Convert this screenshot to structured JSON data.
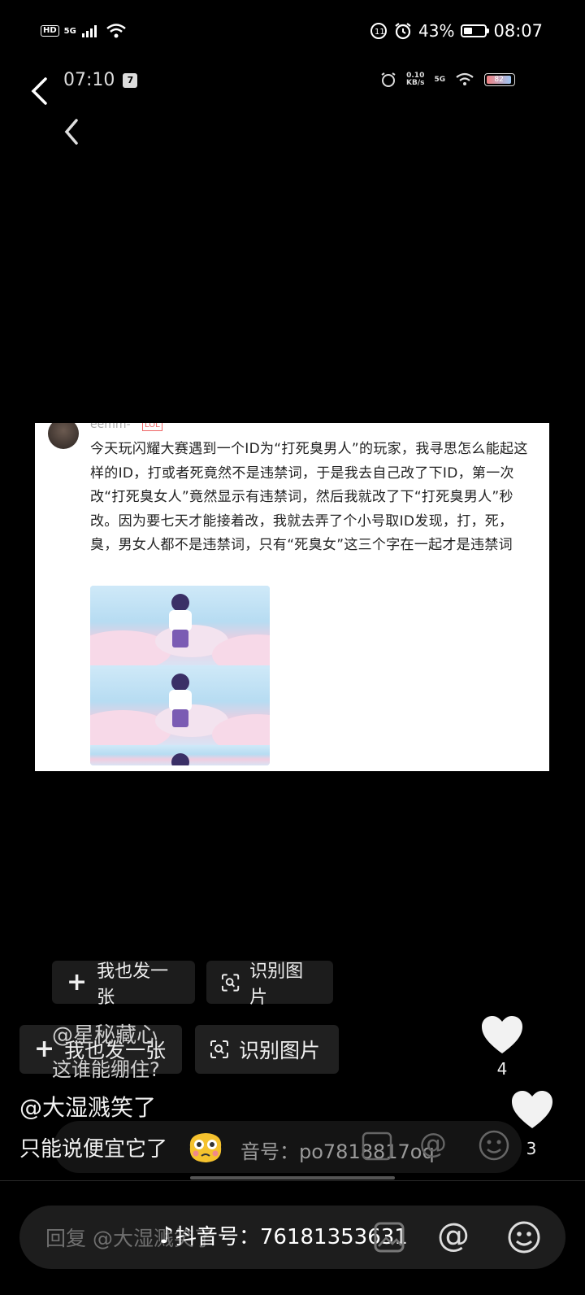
{
  "status_bar": {
    "network_badge": "HD",
    "network_type": "5G",
    "battery_percent": "43%",
    "time": "08:07"
  },
  "inner_status": {
    "time": "07:10",
    "calendar_badge": "7",
    "net_speed_top": "0.10",
    "net_speed_unit": "KB/s",
    "net_type": "5G",
    "battery_level": "82"
  },
  "post": {
    "username": "eemm-",
    "user_tag": "LOL",
    "text": "今天玩闪耀大赛遇到一个ID为“打死臭男人”的玩家，我寻思怎么能起这样的ID，打或者死竟然不是违禁词，于是我去自己改了下ID，第一次改“打死臭女人”竟然显示有违禁词，然后我就改了下“打死臭男人”秒改。因为要七天才能接着改，我就去弄了个小号取ID发现，打，死，臭，男女人都不是违禁词，只有“死臭女”这三个字在一起才是违禁词"
  },
  "actions_upper": {
    "post_one": "我也发一张",
    "recognize": "识别图片"
  },
  "actions_lower": {
    "post_one": "我也发一张",
    "recognize": "识别图片"
  },
  "comments": [
    {
      "user": "@星秘藏心",
      "text": "这谁能绷住?",
      "likes": "4"
    },
    {
      "user": "@大湿溅笑了",
      "text": "只能说便宜它了",
      "likes": "3"
    }
  ],
  "ghost_input": {
    "douyin_id": "音号：po7818817oq"
  },
  "reply": {
    "placeholder": "回复 @大湿溅笑了",
    "douyin_label": "抖音号：76181353631"
  }
}
